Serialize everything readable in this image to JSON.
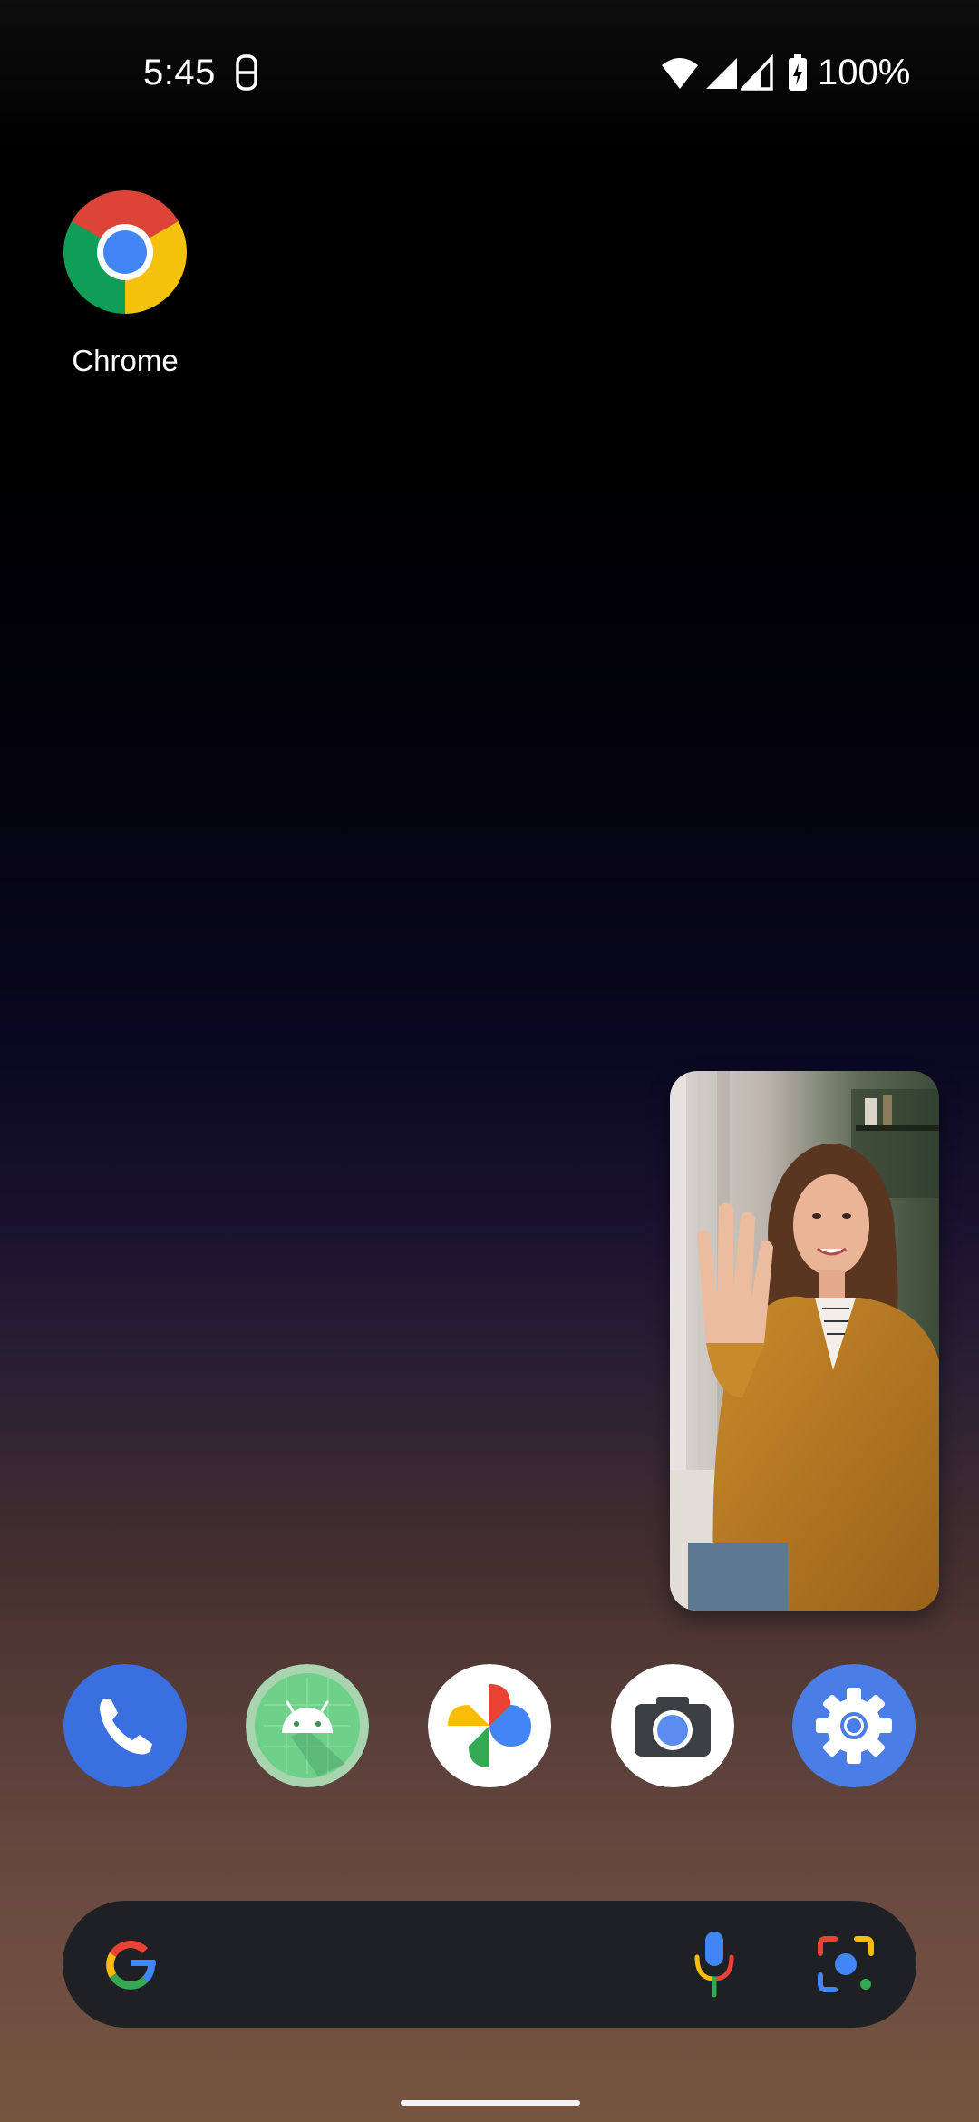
{
  "status_bar": {
    "time": "5:45",
    "battery_percent": "100%",
    "icons": [
      "notification-icon",
      "wifi-icon",
      "cell-signal-icon",
      "cell-signal-2-icon",
      "battery-charging-icon"
    ]
  },
  "home": {
    "apps": [
      {
        "name": "chrome",
        "label": "Chrome"
      }
    ]
  },
  "dock": {
    "apps": [
      "phone-icon",
      "android-studio-icon",
      "photos-icon",
      "camera-icon",
      "settings-icon"
    ]
  },
  "search_bar": {
    "logo": "google-g-icon",
    "actions": [
      "microphone-icon",
      "lens-icon"
    ]
  },
  "colors": {
    "search_bar_bg": "#1f2024",
    "phone_blue": "#3a6fe0",
    "settings_blue": "#4a7ee6"
  }
}
